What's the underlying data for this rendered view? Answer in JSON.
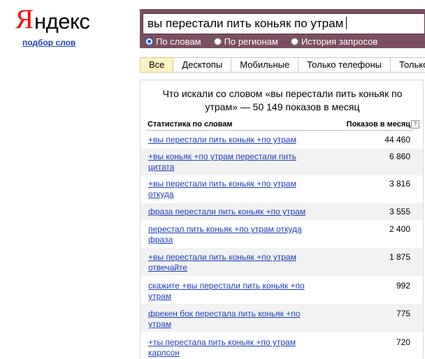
{
  "logo": {
    "first": "Я",
    "rest": "ндекс"
  },
  "subtitle": "подбор слов",
  "search": {
    "query": "вы перестали пить коньяк по утрам",
    "modes": [
      {
        "label": "По словам",
        "selected": true
      },
      {
        "label": "По регионам",
        "selected": false
      },
      {
        "label": "История запросов",
        "selected": false
      }
    ]
  },
  "tabs": [
    "Все",
    "Десктопы",
    "Мобильные",
    "Только телефоны",
    "Только"
  ],
  "results": {
    "title": "Что искали со словом «вы перестали пить коньяк по утрам» — 50 149 показов в месяц",
    "col_words": "Статистика по словам",
    "col_shows": "Показов в месяц",
    "help": "?",
    "rows": [
      {
        "query": "+вы перестали пить коньяк +по утрам",
        "count": "44 460"
      },
      {
        "query": "+вы коньяк +по утрам перестали пить цитата",
        "count": "6 860"
      },
      {
        "query": "+вы перестали пить коньяк +по утрам откуда",
        "count": "3 816"
      },
      {
        "query": "фраза перестали пить коньяк +по утрам",
        "count": "3 555"
      },
      {
        "query": "перестал пить коньяк +по утрам откуда фраза",
        "count": "2 400"
      },
      {
        "query": "+вы перестали пить коньяк +по утрам отвечайте",
        "count": "1 875"
      },
      {
        "query": "скажите +вы перестали пить коньяк +по утрам",
        "count": "992"
      },
      {
        "query": "фрекен бок перестала пить коньяк +по утрам",
        "count": "775"
      },
      {
        "query": "+ты перестала пить коньяк +по утрам карлсон",
        "count": "720"
      }
    ]
  }
}
